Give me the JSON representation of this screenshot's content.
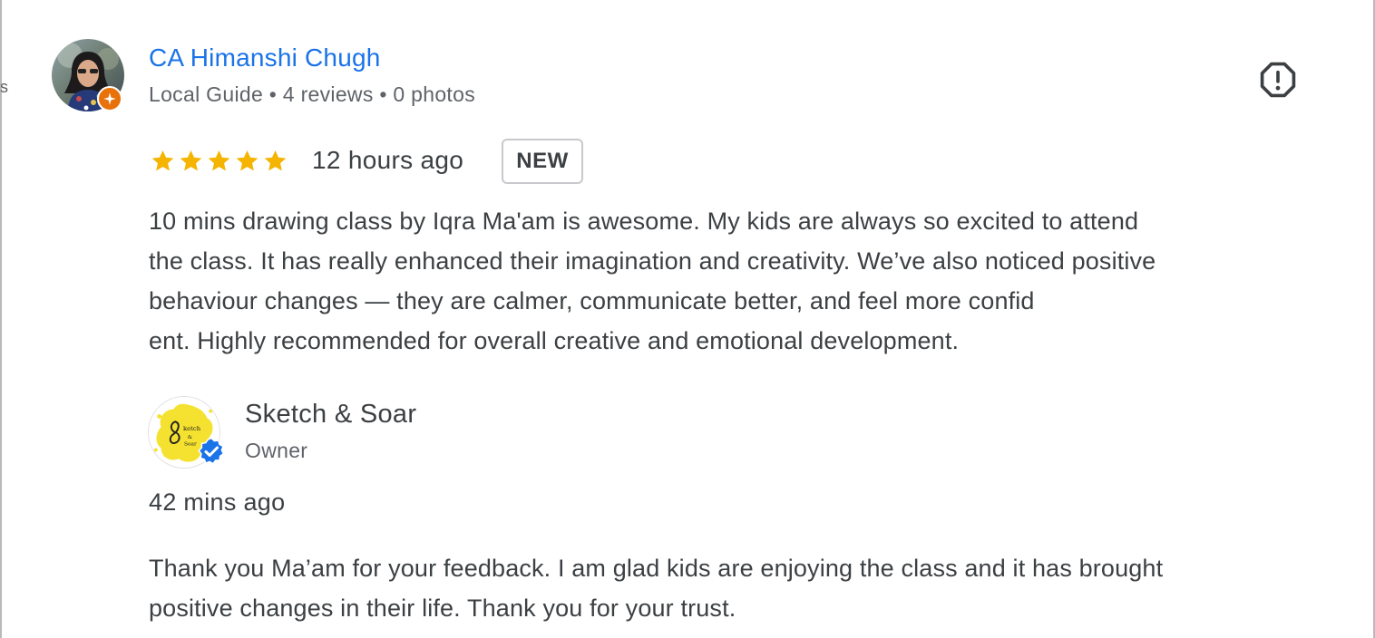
{
  "review": {
    "reviewer": {
      "name": "CA Himanshi Chugh",
      "meta": "Local Guide • 4 reviews • 0 photos",
      "avatar_icon": "profile-photo",
      "badge_icon": "local-guide-star-icon",
      "badge_color": "#e8710a"
    },
    "report_icon": "report-icon",
    "rating": 5,
    "rating_max": 5,
    "star_color": "#f4b400",
    "time": "12 hours ago",
    "badge": "NEW",
    "text_lines": [
      "10 mins drawing class by Iqra Ma'am is awesome. My kids are always so excited to attend",
      "the class. It has really enhanced their imagination and creativity. We’ve also noticed positive",
      "behaviour changes — they are calmer, communicate better, and feel more confid",
      "ent. Highly recommended for overall creative and emotional development."
    ]
  },
  "owner_reply": {
    "name": "Sketch & Soar",
    "role": "Owner",
    "logo_icon": "business-logo",
    "verified_icon": "verified-check-icon",
    "verified_color": "#1a73e8",
    "time": "42 mins ago",
    "text_lines": [
      "Thank you Ma’am for your feedback. I am glad kids are enjoying the class and it has brought",
      "positive changes in their life. Thank you for your trust."
    ]
  },
  "colors": {
    "link": "#1a73e8",
    "text": "#3c4043",
    "secondary": "#5f6368"
  }
}
